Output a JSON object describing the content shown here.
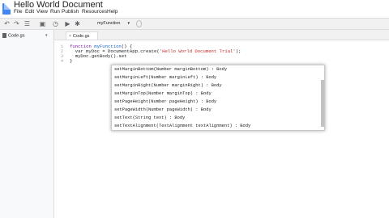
{
  "app": {
    "title": "Hello World Document"
  },
  "menus": [
    "File",
    "Edit",
    "View",
    "Run",
    "Publish",
    "Resources",
    "Help"
  ],
  "toolbar": {
    "icons": [
      "undo-icon",
      "redo-icon",
      "indent-icon",
      "save-icon",
      "clock-icon",
      "run-icon",
      "debug-icon"
    ],
    "function_select": "myFunction",
    "caret": "▾"
  },
  "files": [
    {
      "name": "Code.gs",
      "caret": "▾"
    }
  ],
  "tabs": [
    {
      "label": "Code.gs",
      "close": "×"
    }
  ],
  "editor": {
    "line_numbers": [
      "1",
      "2",
      "3",
      "4"
    ],
    "lines": [
      {
        "kw": "function ",
        "fn": "myFunction",
        "rest": "() {"
      },
      {
        "pre": "  var myDoc = DocumentApp.create(",
        "str": "'Hello World Document Trial'",
        "post": ");"
      },
      {
        "pre": "  myDoc.getBody().set"
      },
      {
        "pre": "}"
      }
    ]
  },
  "autocomplete": {
    "items": [
      "setMarginBottom(Number marginBottom) : Body",
      "setMarginLeft(Number marginLeft) : Body",
      "setMarginRight(Number marginRight) : Body",
      "setMarginTop(Number marginTop) : Body",
      "setPageHeight(Number pageHeight) : Body",
      "setPageWidth(Number pageWidth) : Body",
      "setText(String text) : Body",
      "setTextAlignment(TextAlignment textAlignment) : Body"
    ]
  }
}
